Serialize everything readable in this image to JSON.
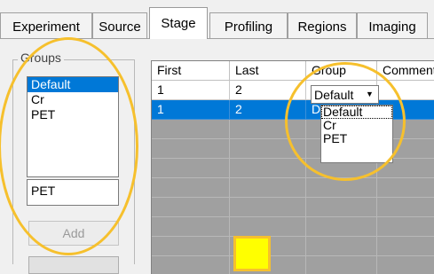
{
  "tabs": [
    {
      "label": "Experiment",
      "active": false
    },
    {
      "label": "Source",
      "active": false
    },
    {
      "label": "Stage",
      "active": true
    },
    {
      "label": "Profiling",
      "active": false
    },
    {
      "label": "Regions",
      "active": false
    },
    {
      "label": "Imaging",
      "active": false
    }
  ],
  "groups_panel": {
    "legend": "Groups",
    "items": [
      "Default",
      "Cr",
      "PET"
    ],
    "selected": "Default",
    "text_value": "PET",
    "add_label": "Add"
  },
  "grid": {
    "columns": [
      "First",
      "Last",
      "Group",
      "Comments"
    ],
    "rows": [
      {
        "first": "1",
        "last": "2",
        "group": "Default"
      },
      {
        "first": "1",
        "last": "2",
        "group": "D"
      }
    ],
    "dropdown_value": "Default",
    "dropdown_options": [
      "Default",
      "Cr",
      "PET"
    ]
  },
  "colors": {
    "selection": "#0078d7",
    "highlight_annotation": "#f6c02d",
    "marker_fill": "#ffff00"
  }
}
